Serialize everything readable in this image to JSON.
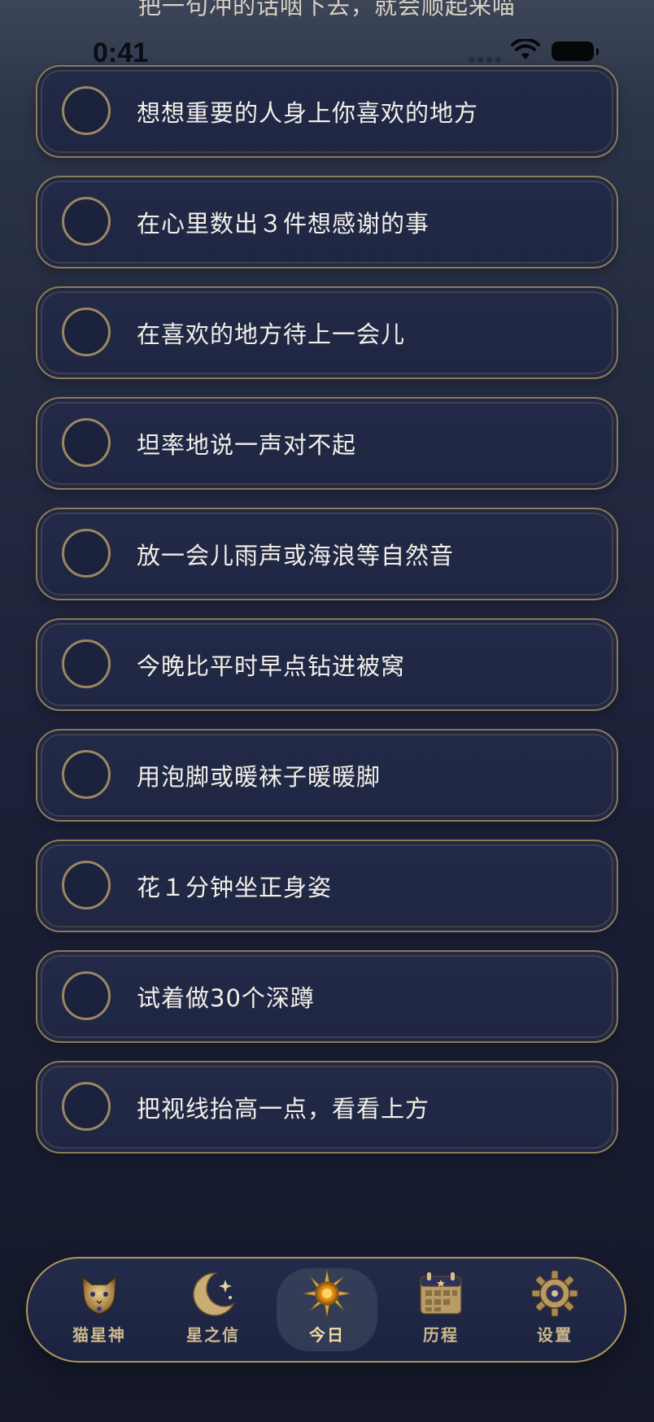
{
  "banner": {
    "text": "把一句冲的话咽下去，就会顺起来喵"
  },
  "status_bar": {
    "time": "0:41"
  },
  "tasks": [
    {
      "label": "想想重要的人身上你喜欢的地方",
      "done": false
    },
    {
      "label": "在心里数出３件想感谢的事",
      "done": false
    },
    {
      "label": "在喜欢的地方待上一会儿",
      "done": false
    },
    {
      "label": "坦率地说一声对不起",
      "done": false
    },
    {
      "label": "放一会儿雨声或海浪等自然音",
      "done": false
    },
    {
      "label": "今晚比平时早点钻进被窝",
      "done": false
    },
    {
      "label": "用泡脚或暖袜子暖暖脚",
      "done": false
    },
    {
      "label": "花１分钟坐正身姿",
      "done": false
    },
    {
      "label": "试着做30个深蹲",
      "done": false
    },
    {
      "label": "把视线抬高一点，看看上方",
      "done": false
    }
  ],
  "tab_bar": {
    "tabs": [
      {
        "label": "猫星神",
        "icon": "cat-deity-icon",
        "active": false
      },
      {
        "label": "星之信",
        "icon": "crescent-moon-icon",
        "active": false
      },
      {
        "label": "今日",
        "icon": "sun-icon",
        "active": true
      },
      {
        "label": "历程",
        "icon": "calendar-icon",
        "active": false
      },
      {
        "label": "设置",
        "icon": "gear-icon",
        "active": false
      }
    ]
  },
  "colors": {
    "card_border": "#8c7a55",
    "tab_bar_border": "#b3975b",
    "tab_label": "#cdb98f",
    "text": "#f3f0e8"
  }
}
